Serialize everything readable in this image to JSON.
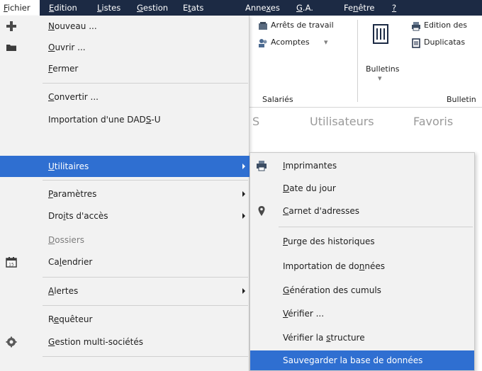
{
  "menubar": {
    "items": [
      {
        "pre": "",
        "u": "F",
        "post": "ichier"
      },
      {
        "pre": "",
        "u": "E",
        "post": "dition"
      },
      {
        "pre": "",
        "u": "L",
        "post": "istes"
      },
      {
        "pre": "",
        "u": "G",
        "post": "estion"
      },
      {
        "pre": "E",
        "u": "t",
        "post": "ats"
      },
      {
        "pre": "Anne",
        "u": "x",
        "post": "es"
      },
      {
        "pre": "",
        "u": "G",
        "post": ".A."
      },
      {
        "pre": "Fe",
        "u": "n",
        "post": "être"
      },
      {
        "pre": "",
        "u": "?",
        "post": ""
      }
    ]
  },
  "ribbon": {
    "arrets": "Arrêts de travail",
    "acomptes": "Acomptes",
    "bulletins": "Bulletins",
    "edition": "Edition des",
    "duplicatas": "Duplicatas",
    "salaries": "Salariés",
    "bulletin_group": "Bulletin"
  },
  "tabs": {
    "s": "S",
    "utilisateurs": "Utilisateurs",
    "favoris": "Favoris"
  },
  "main_menu": {
    "items": [
      {
        "pre": "",
        "u": "N",
        "post": "ouveau ...",
        "icon": "plus-icon"
      },
      {
        "pre": "",
        "u": "O",
        "post": "uvrir ...",
        "icon": "folder-icon"
      },
      {
        "pre": "",
        "u": "F",
        "post": "ermer",
        "icon": ""
      },
      {
        "pre": "",
        "u": "C",
        "post": "onvertir ...",
        "icon": ""
      },
      {
        "pre": "Importation d'une DAD",
        "u": "S",
        "post": "-U",
        "icon": ""
      },
      {
        "pre": "",
        "u": "U",
        "post": "tilitaires",
        "icon": "",
        "selected": true,
        "submenu": true
      },
      {
        "pre": "",
        "u": "P",
        "post": "aramètres",
        "icon": "",
        "submenu": true
      },
      {
        "pre": "Dro",
        "u": "i",
        "post": "ts d'accès",
        "icon": "",
        "submenu": true
      },
      {
        "pre": "",
        "u": "D",
        "post": "ossiers",
        "icon": "",
        "disabled": true
      },
      {
        "pre": "Ca",
        "u": "l",
        "post": "endrier",
        "icon": "calendar-icon"
      },
      {
        "pre": "",
        "u": "A",
        "post": "lertes",
        "icon": "",
        "submenu": true
      },
      {
        "pre": "R",
        "u": "e",
        "post": "quêteur",
        "icon": ""
      },
      {
        "pre": "",
        "u": "G",
        "post": "estion multi-sociétés",
        "icon": "gear-icon"
      }
    ]
  },
  "sub_menu": {
    "items": [
      {
        "pre": "",
        "u": "I",
        "post": "mprimantes",
        "icon": "printer-icon"
      },
      {
        "pre": "",
        "u": "D",
        "post": "ate du jour",
        "icon": ""
      },
      {
        "pre": "",
        "u": "C",
        "post": "arnet d'adresses",
        "icon": "map-pin-icon"
      },
      {
        "pre": "",
        "u": "P",
        "post": "urge des historiques",
        "icon": ""
      },
      {
        "pre": "Importation de do",
        "u": "n",
        "post": "nées",
        "icon": ""
      },
      {
        "pre": "",
        "u": "G",
        "post": "énération des cumuls",
        "icon": ""
      },
      {
        "pre": "",
        "u": "V",
        "post": "érifier ...",
        "icon": ""
      },
      {
        "pre": "Vérifier la ",
        "u": "s",
        "post": "tructure",
        "icon": ""
      },
      {
        "pre": "Sauvegarder la base de données",
        "u": "",
        "post": "",
        "icon": "",
        "selected": true
      }
    ]
  }
}
